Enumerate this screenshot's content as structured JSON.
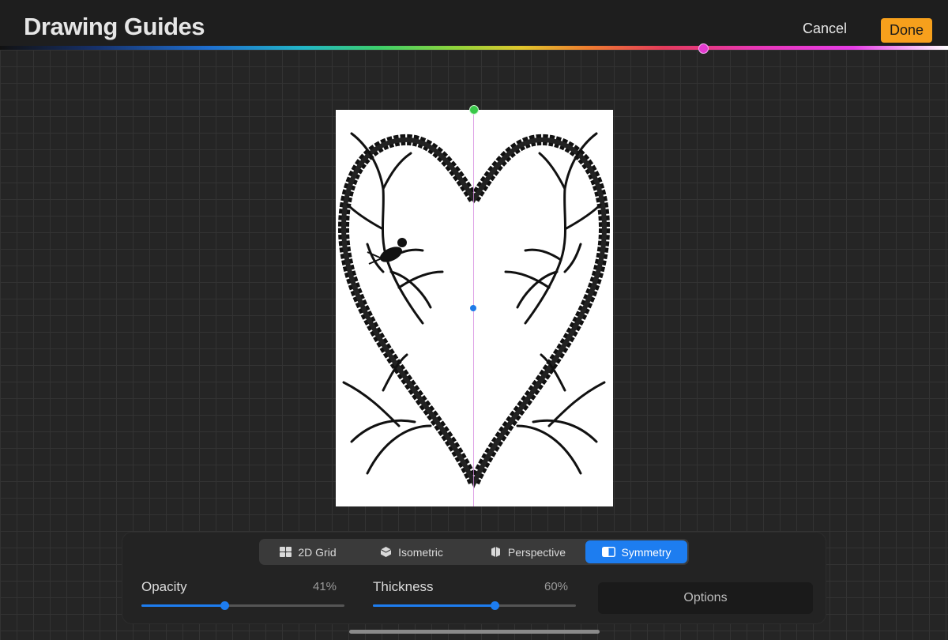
{
  "header": {
    "title": "Drawing Guides",
    "cancel_label": "Cancel",
    "done_label": "Done"
  },
  "colors": {
    "accent": "#1d7df0",
    "done_button": "#f7a01c",
    "symmetry_top_handle": "#3ac84a",
    "symmetry_line": "#d58ae0"
  },
  "guide_types": [
    {
      "label": "2D Grid",
      "icon": "grid-icon",
      "active": false
    },
    {
      "label": "Isometric",
      "icon": "isometric-cube-icon",
      "active": false
    },
    {
      "label": "Perspective",
      "icon": "perspective-cube-icon",
      "active": false
    },
    {
      "label": "Symmetry",
      "icon": "symmetry-icon",
      "active": true
    }
  ],
  "controls": {
    "opacity": {
      "label": "Opacity",
      "value_text": "41%",
      "value": 0.41
    },
    "thickness": {
      "label": "Thickness",
      "value_text": "60%",
      "value": 0.6
    },
    "options_label": "Options"
  }
}
